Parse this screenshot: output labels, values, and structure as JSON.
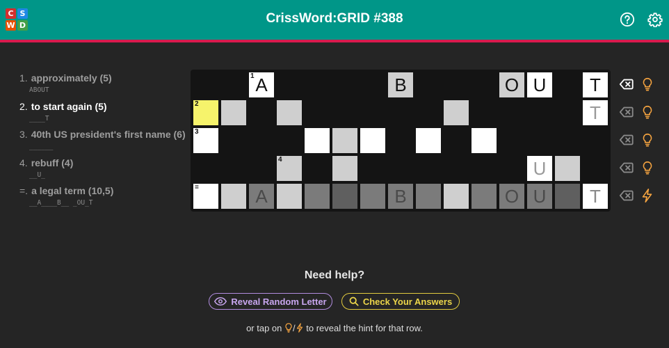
{
  "header": {
    "title": "CrissWord:GRID #388",
    "logo": [
      {
        "letter": "C",
        "color": "#d32f2f"
      },
      {
        "letter": "S",
        "color": "#1e88e5"
      },
      {
        "letter": "W",
        "color": "#e65100"
      },
      {
        "letter": "D",
        "color": "#43a047"
      }
    ],
    "icons": [
      "help-icon",
      "gear-icon"
    ]
  },
  "clues": [
    {
      "num": "1.",
      "text": "approximately (5)",
      "pattern": "ABOUT",
      "active": false
    },
    {
      "num": "2.",
      "text": "to start again (5)",
      "pattern": "____T",
      "active": true
    },
    {
      "num": "3.",
      "text": "40th US president's first name (6)",
      "pattern": "______",
      "active": false
    },
    {
      "num": "4.",
      "text": "rebuff (4)",
      "pattern": "__U_",
      "active": false
    },
    {
      "num": "=.",
      "text": "a legal term (10,5)",
      "pattern": "__A____B__ _OU_T",
      "active": false
    }
  ],
  "grid": {
    "cols": 15,
    "rows": [
      [
        {
          "c": 2,
          "s": "w",
          "l": "A",
          "n": "1"
        },
        {
          "c": 7,
          "s": "g",
          "l": "B"
        },
        {
          "c": 11,
          "s": "g",
          "l": "O"
        },
        {
          "c": 12,
          "s": "w",
          "l": "U"
        },
        {
          "c": 14,
          "s": "w",
          "l": "T"
        }
      ],
      [
        {
          "c": 0,
          "s": "y",
          "n": "2"
        },
        {
          "c": 1,
          "s": "g"
        },
        {
          "c": 3,
          "s": "g"
        },
        {
          "c": 9,
          "s": "g"
        },
        {
          "c": 14,
          "s": "w",
          "l": "T",
          "lc": "#9a9a9a"
        }
      ],
      [
        {
          "c": 0,
          "s": "w",
          "n": "3"
        },
        {
          "c": 4,
          "s": "w"
        },
        {
          "c": 5,
          "s": "g"
        },
        {
          "c": 6,
          "s": "w"
        },
        {
          "c": 8,
          "s": "w"
        },
        {
          "c": 10,
          "s": "w"
        }
      ],
      [
        {
          "c": 3,
          "s": "g",
          "n": "4"
        },
        {
          "c": 5,
          "s": "g"
        },
        {
          "c": 12,
          "s": "w",
          "l": "U",
          "lc": "#9a9a9a"
        },
        {
          "c": 13,
          "s": "g"
        }
      ],
      [
        {
          "c": 0,
          "s": "w",
          "n": "="
        },
        {
          "c": 1,
          "s": "g"
        },
        {
          "c": 2,
          "s": "d1",
          "l": "A"
        },
        {
          "c": 3,
          "s": "g"
        },
        {
          "c": 4,
          "s": "d1"
        },
        {
          "c": 5,
          "s": "d2"
        },
        {
          "c": 6,
          "s": "d1"
        },
        {
          "c": 7,
          "s": "d1",
          "l": "B"
        },
        {
          "c": 8,
          "s": "d1"
        },
        {
          "c": 9,
          "s": "g"
        },
        {
          "c": 10,
          "s": "d1"
        },
        {
          "c": 11,
          "s": "d1",
          "l": "O"
        },
        {
          "c": 12,
          "s": "d1",
          "l": "U"
        },
        {
          "c": 13,
          "s": "d2"
        },
        {
          "c": 14,
          "s": "w",
          "l": "T",
          "lc": "#8a8a8a"
        }
      ]
    ],
    "colors": {
      "w": "#ffffff",
      "g": "#cfcfcf",
      "y": "#f6f36b",
      "d1": "#7b7b7b",
      "d2": "#5f5f5f"
    }
  },
  "row_actions": [
    {
      "clear": "clear-icon",
      "hint": "bulb-icon",
      "clear_color": "#ffffff",
      "hint_color": "#f4a340"
    },
    {
      "clear": "clear-icon",
      "hint": "bulb-icon",
      "clear_color": "#8a8a8a",
      "hint_color": "#f4a340"
    },
    {
      "clear": "clear-icon",
      "hint": "bulb-icon",
      "clear_color": "#8a8a8a",
      "hint_color": "#f4a340"
    },
    {
      "clear": "clear-icon",
      "hint": "bulb-icon",
      "clear_color": "#8a8a8a",
      "hint_color": "#f4a340"
    },
    {
      "clear": "clear-icon",
      "hint": "bolt-icon",
      "clear_color": "#8a8a8a",
      "hint_color": "#f4a340"
    }
  ],
  "help": {
    "title": "Need help?",
    "reveal_label": "Reveal Random Letter",
    "check_label": "Check Your Answers",
    "footer_prefix": "or tap on ",
    "footer_sep": "/",
    "footer_suffix": " to reveal the hint for that row."
  },
  "colors": {
    "header": "#009688",
    "accent_line": "#d81b4e",
    "reveal": "#c8a6ef",
    "check": "#ecd64a",
    "hint": "#f4a340"
  }
}
